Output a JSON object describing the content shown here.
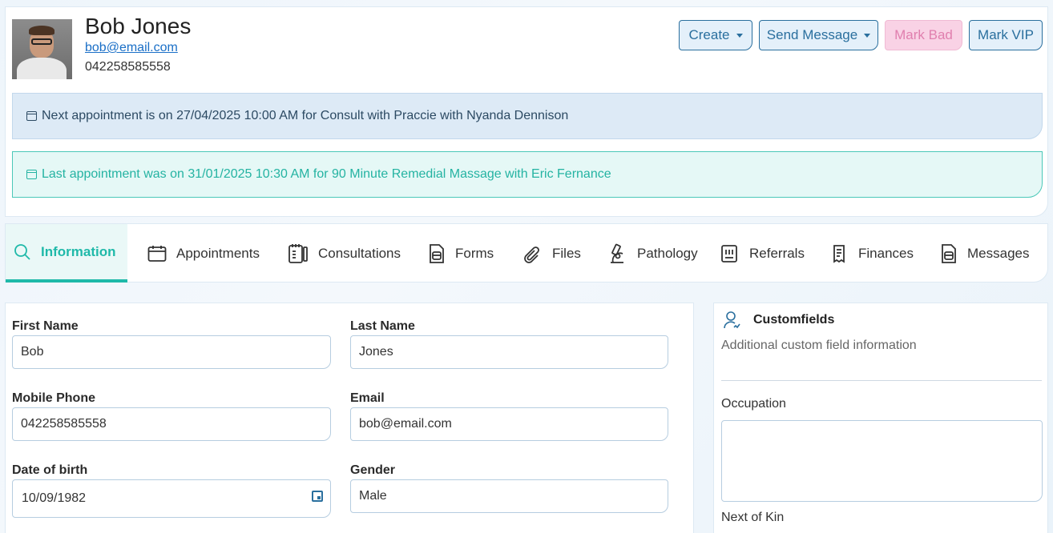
{
  "patient": {
    "name": "Bob Jones",
    "email": "bob@email.com",
    "phone": "042258585558"
  },
  "actions": {
    "create": "Create",
    "send_message": "Send Message",
    "mark_bad": "Mark Bad",
    "mark_vip": "Mark VIP"
  },
  "alerts": {
    "next": "Next appointment is on 27/04/2025 10:00 AM for Consult with Praccie with Nyanda Dennison",
    "last": "Last appointment was on 31/01/2025 10:30 AM for 90 Minute Remedial Massage with Eric Fernance"
  },
  "tabs": [
    {
      "label": "Information",
      "icon": "search-icon",
      "active": true
    },
    {
      "label": "Appointments",
      "icon": "calendar-icon"
    },
    {
      "label": "Consultations",
      "icon": "notes-icon"
    },
    {
      "label": "Forms",
      "icon": "form-icon"
    },
    {
      "label": "Files",
      "icon": "paperclip-icon"
    },
    {
      "label": "Pathology",
      "icon": "microscope-icon"
    },
    {
      "label": "Referrals",
      "icon": "referral-icon"
    },
    {
      "label": "Finances",
      "icon": "receipt-icon"
    },
    {
      "label": "Messages",
      "icon": "message-icon"
    }
  ],
  "form": {
    "first_name": {
      "label": "First Name",
      "value": "Bob"
    },
    "last_name": {
      "label": "Last Name",
      "value": "Jones"
    },
    "mobile": {
      "label": "Mobile Phone",
      "value": "042258585558"
    },
    "email": {
      "label": "Email",
      "value": "bob@email.com"
    },
    "dob": {
      "label": "Date of birth",
      "value": "10/09/1982"
    },
    "gender": {
      "label": "Gender",
      "value": "Male"
    }
  },
  "customfields": {
    "title": "Customfields",
    "subtitle": "Additional custom field information",
    "occupation_label": "Occupation",
    "next_of_kin_label": "Next of Kin"
  },
  "colors": {
    "accent": "#1fb9a9",
    "primary": "#2a6f9e",
    "mark_bad": "#f9d2e5"
  }
}
